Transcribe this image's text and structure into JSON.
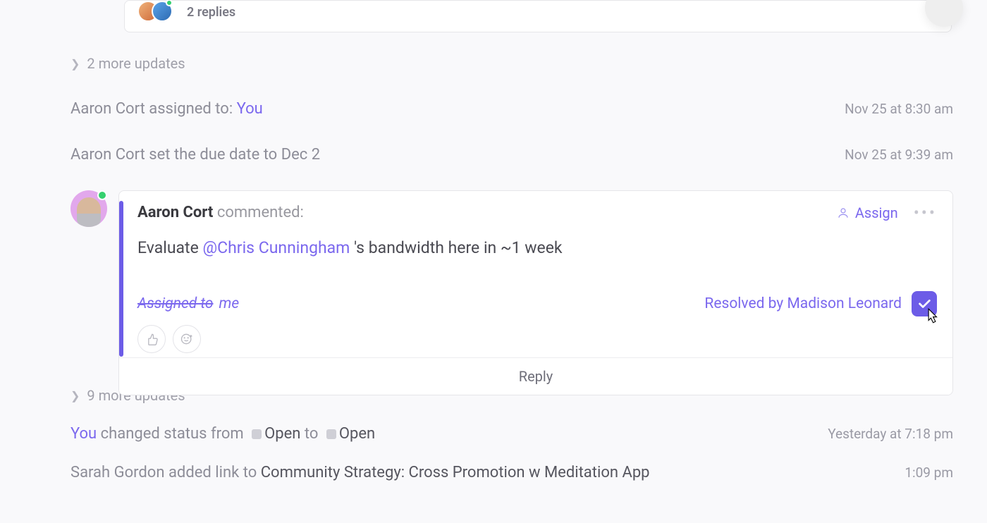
{
  "repliesStub": {
    "text": "2 replies"
  },
  "moreUpdates1": {
    "text": "2 more updates"
  },
  "act1": {
    "actor": "Aaron Cort",
    "verb": " assigned to: ",
    "target": "You",
    "ts": "Nov 25 at 8:30 am"
  },
  "act2": {
    "actor": "Aaron Cort",
    "verb": " set the due date to ",
    "value": "Dec 2",
    "ts": "Nov 25 at 9:39 am"
  },
  "comment": {
    "author": "Aaron Cort",
    "headSuffix": " commented:",
    "body_pre": "Evaluate ",
    "mention": "@Chris Cunningham",
    "body_post": " 's bandwidth here in ~1 week",
    "assignedStrike": "Assigned to",
    "assignedMe": "me",
    "resolvedText": "Resolved by Madison Leonard",
    "assignLabel": "Assign",
    "replyLabel": "Reply"
  },
  "moreUpdates2": {
    "text": "9 more updates"
  },
  "act3": {
    "actor": "You",
    "verb": " changed status from ",
    "from": "Open",
    "mid": " to ",
    "to": "Open",
    "ts": "Yesterday at 7:18 pm"
  },
  "act4": {
    "actor": "Sarah Gordon",
    "verb": " added link to ",
    "link": "Community Strategy: Cross Promotion w Meditation App",
    "ts": "1:09 pm"
  }
}
